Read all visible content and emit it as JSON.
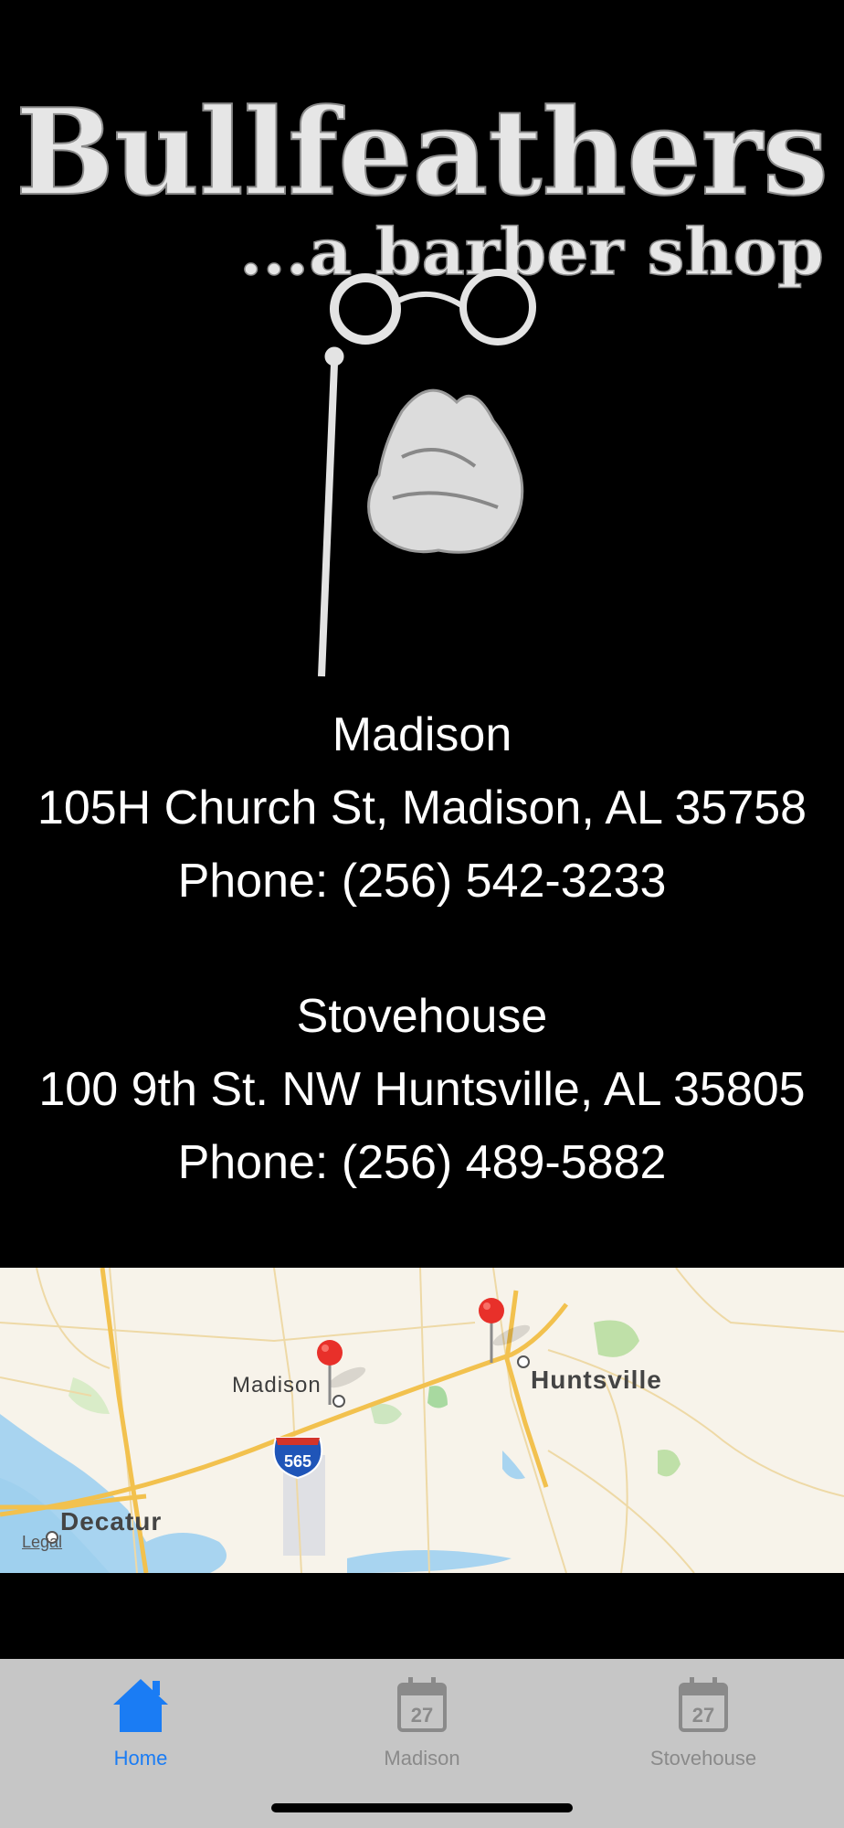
{
  "brand": {
    "name": "Bullfeathers",
    "tagline": "...a barber shop"
  },
  "locations": [
    {
      "name": "Madison",
      "address": "105H Church St, Madison, AL 35758",
      "phone": "Phone: (256) 542-3233"
    },
    {
      "name": "Stovehouse",
      "address": "100 9th St. NW Huntsville, AL 35805",
      "phone": "Phone: (256) 489-5882"
    }
  ],
  "map": {
    "labels": {
      "madison": "Madison",
      "huntsville": "Huntsville",
      "decatur": "Decatur",
      "highway": "565"
    },
    "legal": "Legal",
    "pin_color": "#e8302a"
  },
  "tabbar": {
    "tabs": [
      {
        "label": "Home",
        "icon": "home-icon",
        "active": true
      },
      {
        "label": "Madison",
        "icon": "calendar-icon",
        "badge": "27",
        "active": false
      },
      {
        "label": "Stovehouse",
        "icon": "calendar-icon",
        "badge": "27",
        "active": false
      }
    ],
    "active_color": "#1a7cf4",
    "inactive_color": "#8a8a8a"
  }
}
